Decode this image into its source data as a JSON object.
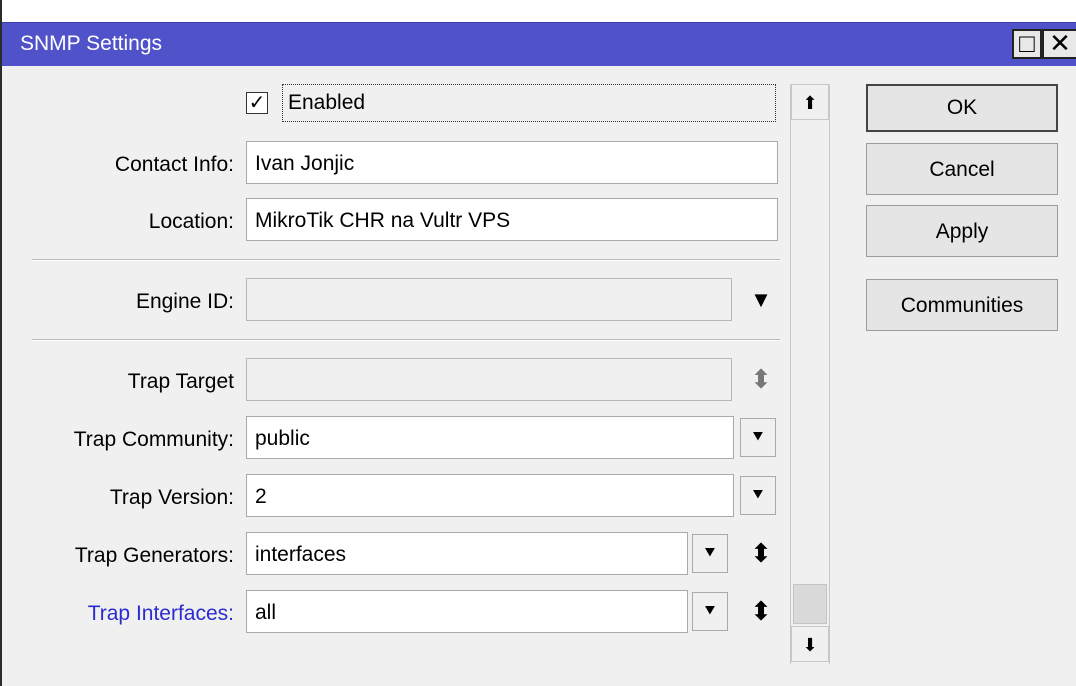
{
  "window": {
    "title": "SNMP Settings",
    "maximize_glyph": "□",
    "close_glyph": "✕"
  },
  "form": {
    "enabled": {
      "label": "Enabled",
      "checked": true,
      "check_glyph": "✓"
    },
    "contact_info": {
      "label": "Contact Info:",
      "value": "Ivan Jonjic"
    },
    "location": {
      "label": "Location:",
      "value": "MikroTik CHR na Vultr VPS"
    },
    "engine_id": {
      "label": "Engine ID:",
      "value": "",
      "dropdown_glyph": "▼"
    },
    "trap_target": {
      "label": "Trap Target",
      "value": "",
      "updown_glyph": "⬍"
    },
    "trap_community": {
      "label": "Trap Community:",
      "value": "public",
      "dropdown_glyph": "⯆"
    },
    "trap_version": {
      "label": "Trap Version:",
      "value": "2",
      "dropdown_glyph": "⯆"
    },
    "trap_generators": {
      "label": "Trap Generators:",
      "value": "interfaces",
      "dropdown_glyph": "⯆",
      "updown_glyph": "⬍"
    },
    "trap_interfaces": {
      "label": "Trap Interfaces:",
      "value": "all",
      "dropdown_glyph": "⯆",
      "updown_glyph": "⬍",
      "label_color": "#2b2bd1"
    }
  },
  "scrollbar": {
    "up_glyph": "⬆",
    "down_glyph": "⬇"
  },
  "buttons": {
    "ok": "OK",
    "cancel": "Cancel",
    "apply": "Apply",
    "communities": "Communities"
  },
  "colors": {
    "titlebar": "#4f52c9",
    "link_label": "#2b2bd1"
  }
}
